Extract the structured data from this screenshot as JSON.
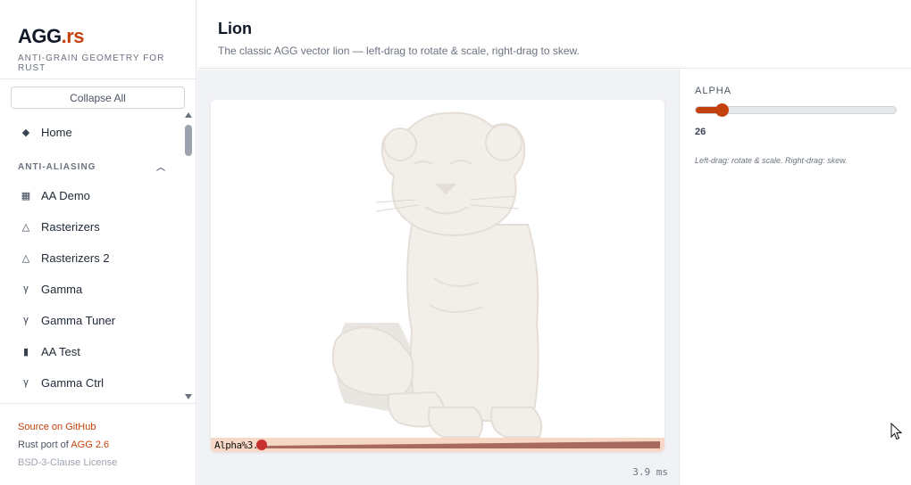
{
  "brand": {
    "name": "AGG",
    "suffix": ".rs",
    "subtitle": "ANTI-GRAIN GEOMETRY FOR RUST"
  },
  "sidebar": {
    "collapse_label": "Collapse All",
    "home": {
      "label": "Home",
      "icon": "diamond-icon"
    },
    "section": {
      "label": "ANTI-ALIASING",
      "icon": "chevron-up-icon"
    },
    "items": [
      {
        "label": "AA Demo",
        "icon": "grid-icon",
        "glyph": "▦"
      },
      {
        "label": "Rasterizers",
        "icon": "triangle-icon",
        "glyph": "△"
      },
      {
        "label": "Rasterizers 2",
        "icon": "triangle-icon",
        "glyph": "△"
      },
      {
        "label": "Gamma",
        "icon": "gamma-icon",
        "glyph": "γ"
      },
      {
        "label": "Gamma Tuner",
        "icon": "gamma-icon",
        "glyph": "γ"
      },
      {
        "label": "AA Test",
        "icon": "bar-icon",
        "glyph": "▮"
      },
      {
        "label": "Gamma Ctrl",
        "icon": "gamma-icon",
        "glyph": "γ"
      }
    ],
    "footer": {
      "source_link": "Source on GitHub",
      "port_prefix": "Rust port of",
      "port_link": "AGG 2.6",
      "license": "BSD-3-Clause License"
    }
  },
  "header": {
    "title": "Lion",
    "subtitle": "The classic AGG vector lion — left-drag to rotate & scale, right-drag to skew."
  },
  "canvas": {
    "alpha_label": "Alpha%3.",
    "render_time": "3.9 ms"
  },
  "controls": {
    "alpha": {
      "label": "ALPHA",
      "value": "26",
      "fraction": 0.13
    },
    "hint": "Left-drag: rotate & scale. Right-drag: skew."
  },
  "colors": {
    "accent": "#c2410c",
    "canvas_bg": "#f1f2f5",
    "strip": "#f7d8c7"
  }
}
